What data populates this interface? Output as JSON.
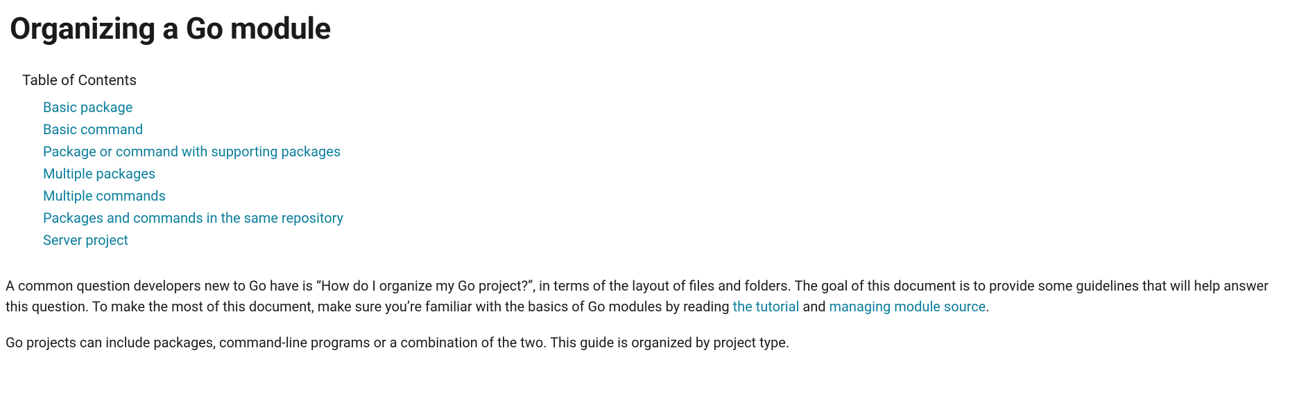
{
  "title": "Organizing a Go module",
  "toc": {
    "heading": "Table of Contents",
    "items": [
      "Basic package",
      "Basic command",
      "Package or command with supporting packages",
      "Multiple packages",
      "Multiple commands",
      "Packages and commands in the same repository",
      "Server project"
    ]
  },
  "body": {
    "p1_a": "A common question developers new to Go have is “How do I organize my Go project?”, in terms of the layout of files and folders. The goal of this document is to provide some guidelines that will help answer this question. To make the most of this document, make sure you’re familiar with the basics of Go modules by reading ",
    "p1_link1": "the tutorial",
    "p1_b": " and ",
    "p1_link2": "managing module source",
    "p1_c": ".",
    "p2": "Go projects can include packages, command-line programs or a combination of the two. This guide is organized by project type."
  }
}
